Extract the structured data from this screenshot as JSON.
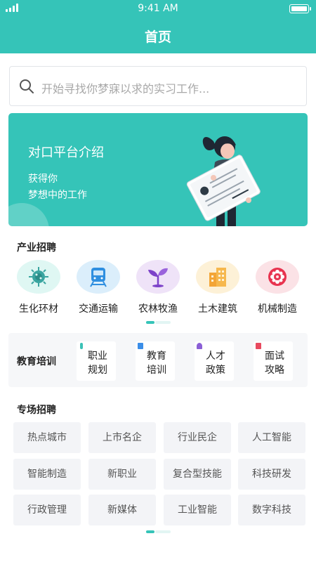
{
  "status_bar": {
    "time": "9:41 AM",
    "battery_level": 1.0
  },
  "header": {
    "title": "首页"
  },
  "search": {
    "placeholder": "开始寻找你梦寐以求的实习工作..."
  },
  "banner": {
    "title": "对口平台介绍",
    "subtitle_line1": "获得你",
    "subtitle_line2": "梦想中的工作"
  },
  "industry": {
    "title": "产业招聘",
    "items": [
      {
        "label": "生化环材",
        "icon": "microbe-icon",
        "bg": "#dff7f3"
      },
      {
        "label": "交通运输",
        "icon": "train-icon",
        "bg": "#dbeefb"
      },
      {
        "label": "农林牧渔",
        "icon": "sprout-icon",
        "bg": "#efe3f8"
      },
      {
        "label": "土木建筑",
        "icon": "building-icon",
        "bg": "#fdf1d7"
      },
      {
        "label": "机械制造",
        "icon": "gear-icon",
        "bg": "#fbe2e6"
      }
    ]
  },
  "education": {
    "title": "教育培训",
    "items": [
      {
        "line1": "职业",
        "line2": "规划",
        "icon": "test-tube-icon",
        "color": "#3ac1b6"
      },
      {
        "line1": "教育",
        "line2": "培训",
        "icon": "book-icon",
        "color": "#3b8ee8"
      },
      {
        "line1": "人才",
        "line2": "政策",
        "icon": "person-icon",
        "color": "#8b5fd6"
      },
      {
        "line1": "面试",
        "line2": "攻略",
        "icon": "document-icon",
        "color": "#e84a5f"
      }
    ]
  },
  "special": {
    "title": "专场招聘",
    "items": [
      "热点城市",
      "上市名企",
      "行业民企",
      "人工智能",
      "智能制造",
      "新职业",
      "复合型技能",
      "科技研发",
      "行政管理",
      "新媒体",
      "工业智能",
      "数字科技"
    ]
  },
  "colors": {
    "accent": "#35c4b8"
  }
}
